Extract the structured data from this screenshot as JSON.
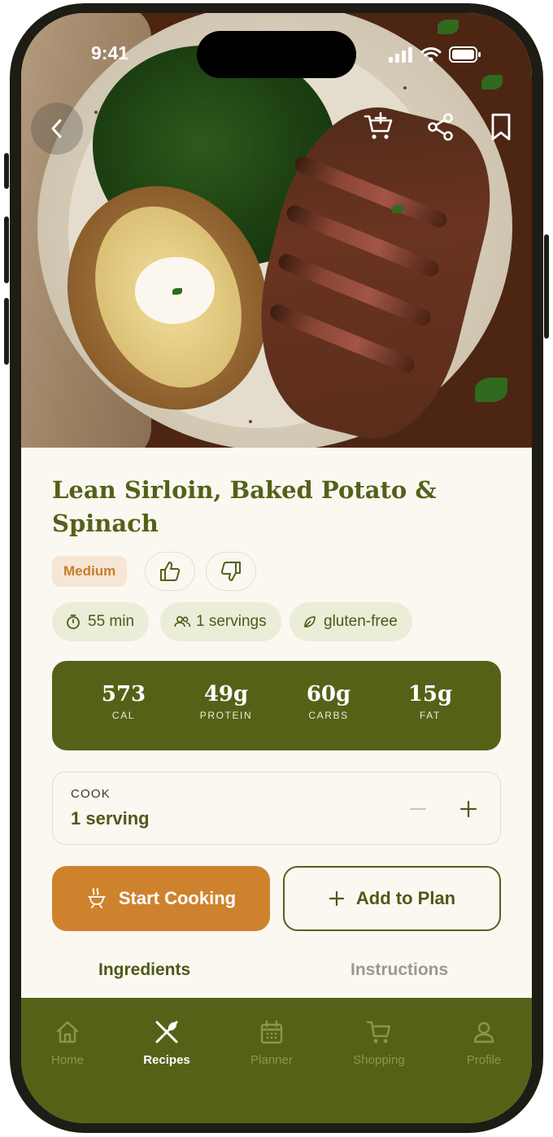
{
  "status_bar": {
    "time": "9:41"
  },
  "recipe": {
    "title": "Lean Sirloin, Baked Potato & Spinach",
    "difficulty": "Medium",
    "chips": [
      {
        "icon": "timer-icon",
        "label": "55 min"
      },
      {
        "icon": "people-icon",
        "label": "1 servings"
      },
      {
        "icon": "leaf-icon",
        "label": "gluten-free"
      }
    ],
    "nutrition": [
      {
        "value": "573",
        "label": "CAL"
      },
      {
        "value": "49g",
        "label": "PROTEIN"
      },
      {
        "value": "60g",
        "label": "CARBS"
      },
      {
        "value": "15g",
        "label": "FAT"
      }
    ]
  },
  "cook": {
    "label": "COOK",
    "value": "1 serving"
  },
  "actions": {
    "start_label": "Start Cooking",
    "plan_label": "Add to Plan"
  },
  "tabs": [
    {
      "label": "Ingredients",
      "active": true
    },
    {
      "label": "Instructions",
      "active": false
    }
  ],
  "nav": [
    {
      "label": "Home",
      "icon": "home-icon",
      "active": false
    },
    {
      "label": "Recipes",
      "icon": "fork-spoon-icon",
      "active": true
    },
    {
      "label": "Planner",
      "icon": "calendar-icon",
      "active": false
    },
    {
      "label": "Shopping",
      "icon": "cart-icon",
      "active": false
    },
    {
      "label": "Profile",
      "icon": "person-icon",
      "active": false
    }
  ],
  "colors": {
    "primary": "#566118",
    "accent": "#cf822d",
    "background": "#faf8f1",
    "chip": "#ebedd9",
    "difficulty_bg": "#f6e6d6"
  }
}
